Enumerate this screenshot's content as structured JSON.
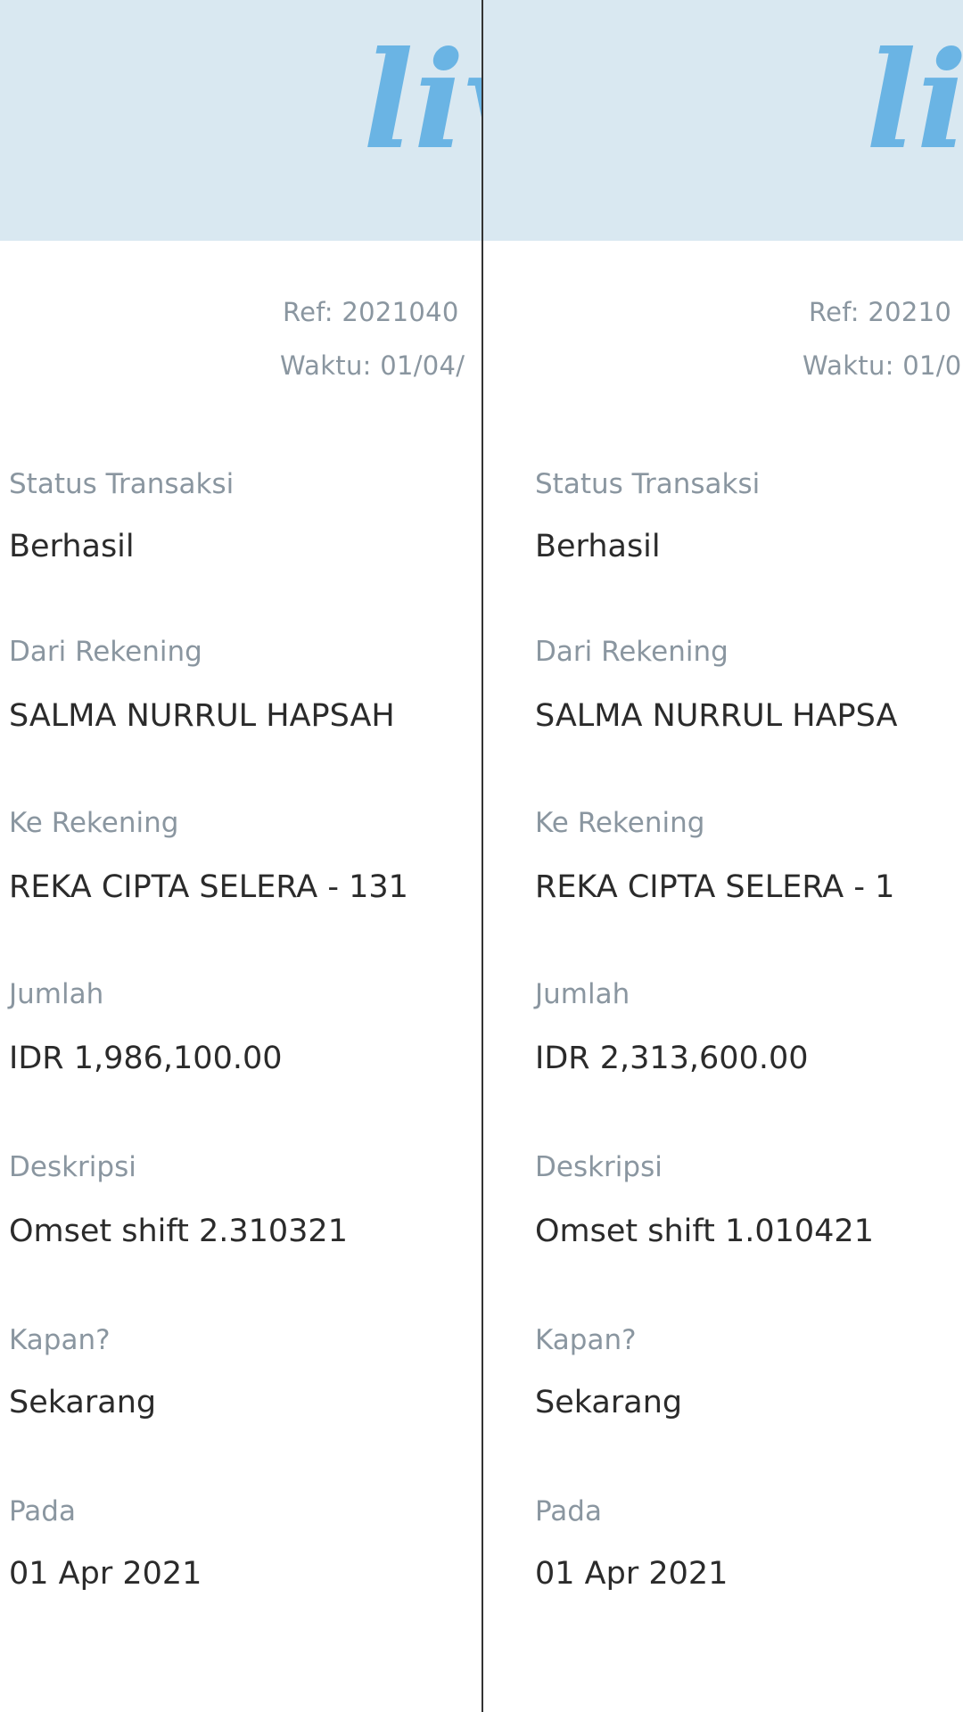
{
  "brand": {
    "logo_text": "live",
    "banner_color": "#d9e8f1",
    "logo_color": "#6ab4e4"
  },
  "receipts": [
    {
      "ref": "Ref: 2021040",
      "waktu": "Waktu: 01/04/",
      "fields": [
        {
          "label": "Status Transaksi",
          "value": "Berhasil"
        },
        {
          "label": "Dari Rekening",
          "value": "SALMA NURRUL HAPSAH"
        },
        {
          "label": "Ke Rekening",
          "value": "REKA CIPTA SELERA - 131"
        },
        {
          "label": "Jumlah",
          "value": "IDR 1,986,100.00"
        },
        {
          "label": "Deskripsi",
          "value": "Omset shift 2.310321"
        },
        {
          "label": "Kapan?",
          "value": "Sekarang"
        },
        {
          "label": "Pada",
          "value": "01 Apr 2021"
        }
      ]
    },
    {
      "ref": "Ref: 20210",
      "waktu": "Waktu: 01/0",
      "fields": [
        {
          "label": "Status Transaksi",
          "value": "Berhasil"
        },
        {
          "label": "Dari Rekening",
          "value": "SALMA NURRUL HAPSA"
        },
        {
          "label": "Ke Rekening",
          "value": "REKA CIPTA SELERA - 1"
        },
        {
          "label": "Jumlah",
          "value": "IDR 2,313,600.00"
        },
        {
          "label": "Deskripsi",
          "value": "Omset shift 1.010421"
        },
        {
          "label": "Kapan?",
          "value": "Sekarang"
        },
        {
          "label": "Pada",
          "value": "01 Apr 2021"
        }
      ]
    }
  ]
}
